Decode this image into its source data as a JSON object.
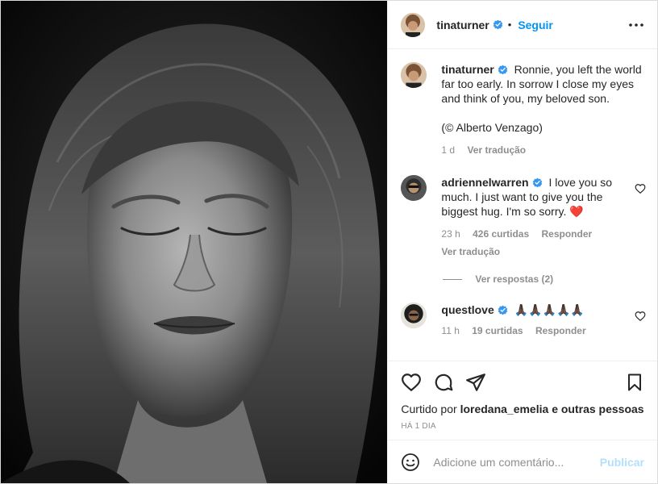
{
  "post": {
    "author": "tinaturner",
    "follow_label": "Seguir",
    "dot": "•",
    "more_icon": "more-horizontal-icon",
    "photo_alt": "Black and white portrait, eyes closed"
  },
  "caption": {
    "author": "tinaturner",
    "text": "Ronnie, you left the world far too early. In sorrow I close my eyes and think of you, my beloved son.",
    "credit": "(© Alberto Venzago)",
    "time": "1 d",
    "translate": "Ver tradução"
  },
  "comments": [
    {
      "author": "adriennelwarren",
      "text": "I love you so much. I just want to give you the biggest hug. I'm so sorry.",
      "emoji": "❤️",
      "time": "23 h",
      "likes": "426 curtidas",
      "reply": "Responder",
      "translate": "Ver tradução",
      "view_replies": "Ver respostas (2)"
    },
    {
      "author": "questlove",
      "emoji": "🙏🏿🙏🏿🙏🏿🙏🏿🙏🏿",
      "time": "11 h",
      "likes": "19 curtidas",
      "reply": "Responder"
    }
  ],
  "likes": {
    "prefix": "Curtido por",
    "user": "loredana_emelia",
    "suffix": "e outras pessoas"
  },
  "timestamp": "HÁ 1 DIA",
  "add_comment": {
    "placeholder": "Adicione um comentário...",
    "publish": "Publicar"
  },
  "colors": {
    "accent": "#0095f6",
    "verified": "#3897f0",
    "publish_disabled": "#b2dffc",
    "heart": "#ed4956"
  }
}
